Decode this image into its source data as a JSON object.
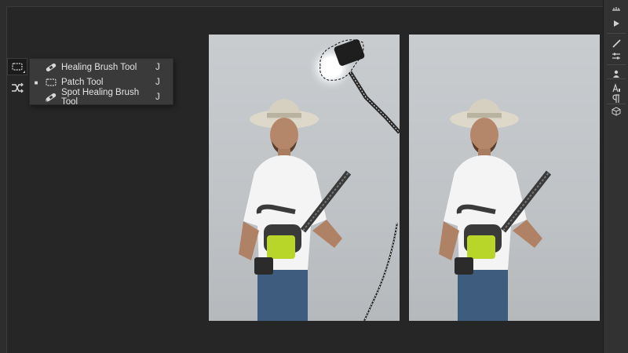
{
  "tool_flyout": {
    "items": [
      {
        "label": "Healing Brush Tool",
        "shortcut": "J",
        "selected": false,
        "icon": "healing-brush-icon"
      },
      {
        "label": "Patch Tool",
        "shortcut": "J",
        "selected": true,
        "icon": "patch-icon"
      },
      {
        "label": "Spot Healing Brush Tool",
        "shortcut": "J",
        "selected": false,
        "icon": "spot-healing-brush-icon"
      }
    ]
  },
  "toolbar": {
    "tools": [
      {
        "icon": "patch-icon",
        "active": true
      },
      {
        "icon": "content-aware-move-icon",
        "active": false
      }
    ]
  },
  "colors": {
    "canvas_bg": "#262626",
    "flyout_bg": "#3a3a3a",
    "panel_bg": "#323232"
  }
}
